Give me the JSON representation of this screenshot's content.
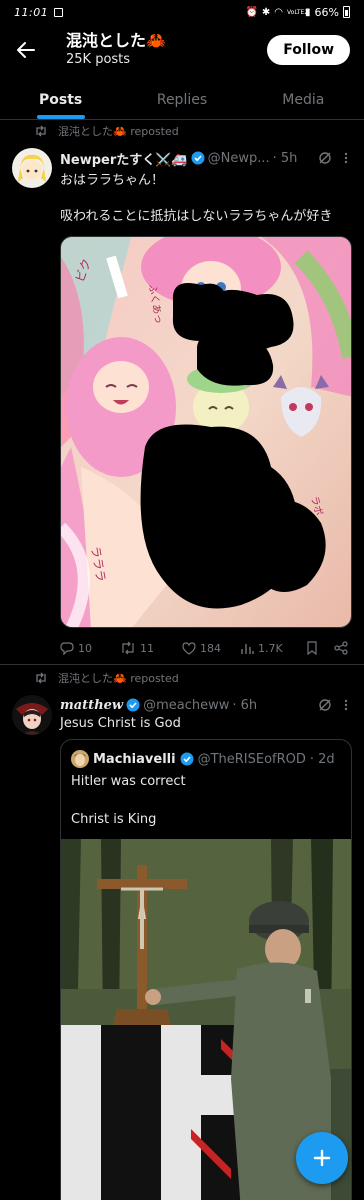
{
  "status_bar": {
    "time": "11:01",
    "battery": "66%",
    "network": "VoLTE2"
  },
  "header": {
    "profile_name": "混沌とした🦀",
    "post_count": "25K posts",
    "follow_label": "Follow"
  },
  "tabs": [
    {
      "label": "Posts"
    },
    {
      "label": "Replies"
    },
    {
      "label": "Media"
    }
  ],
  "tweets": [
    {
      "repost_label": "混沌とした🦀 reposted",
      "display_name": "Newperたすく⚔️🚑",
      "handle": "@Newp...",
      "time": "· 5h",
      "text": "おはララちゃん！\n\n吸われることに抵抗はしないララちゃんが好き",
      "media_labels": {
        "sfx_top": "ビク",
        "sfx_right": "ラボ",
        "sfx_left": "ふくあっ",
        "sfx_bottom": "ラララ"
      },
      "stats": {
        "replies": "10",
        "reposts": "11",
        "likes": "184",
        "views": "1.7K"
      }
    },
    {
      "repost_label": "混沌とした🦀 reposted",
      "display_name": "matthew",
      "handle": "@meacheww",
      "time": "· 6h",
      "text": "Jesus Christ is God",
      "quote": {
        "display_name": "Machiavelli",
        "handle": "@TheRISEofROD",
        "time": "· 2d",
        "text": "Hitler was correct\n\nChrist is King"
      }
    }
  ],
  "colors": {
    "accent": "#1d9bf0",
    "background": "#000000",
    "muted": "#71767b",
    "text": "#e7e9ea"
  },
  "icons": [
    "back-arrow-icon",
    "repost-icon",
    "verified-icon",
    "grok-icon",
    "more-icon",
    "reply-icon",
    "like-icon",
    "views-icon",
    "bookmark-icon",
    "share-icon",
    "plus-icon"
  ]
}
